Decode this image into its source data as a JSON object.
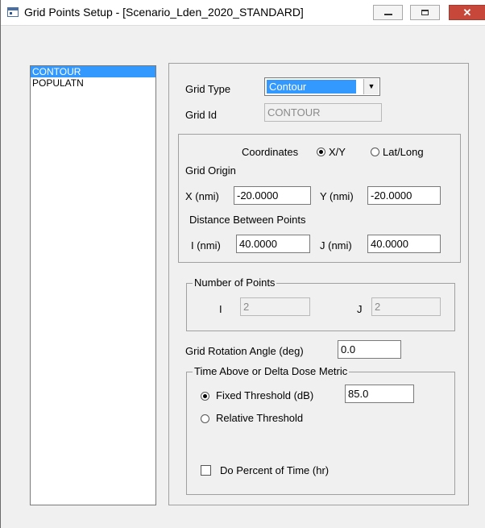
{
  "window": {
    "title": "Grid Points Setup - [Scenario_Lden_2020_STANDARD]",
    "close_glyph": "✕"
  },
  "grid_list": {
    "items": [
      "CONTOUR",
      "POPULATN"
    ],
    "selected": "CONTOUR"
  },
  "grid_type": {
    "label": "Grid Type",
    "value": "Contour",
    "arrow": "▼"
  },
  "grid_id": {
    "label": "Grid Id",
    "value": "CONTOUR"
  },
  "coordinates": {
    "label": "Coordinates",
    "options": [
      "X/Y",
      "Lat/Long"
    ],
    "selected": "X/Y",
    "grid_origin_label": "Grid Origin",
    "x_label": "X (nmi)",
    "x_value": "-20.0000",
    "y_label": "Y (nmi)",
    "y_value": "-20.0000",
    "distance_label": "Distance Between Points",
    "i_label": "I (nmi)",
    "i_value": "40.0000",
    "j_label": "J (nmi)",
    "j_value": "40.0000"
  },
  "number_of_points": {
    "legend": "Number of Points",
    "i_label": "I",
    "i_value": "2",
    "j_label": "J",
    "j_value": "2"
  },
  "rotation": {
    "label": "Grid Rotation Angle (deg)",
    "value": "0.0"
  },
  "time_above": {
    "legend": "Time Above or Delta Dose Metric",
    "fixed_label": "Fixed Threshold (dB)",
    "fixed_value": "85.0",
    "relative_label": "Relative Threshold",
    "selected": "fixed",
    "percent_label": "Do Percent of Time (hr)",
    "percent_checked": false
  }
}
